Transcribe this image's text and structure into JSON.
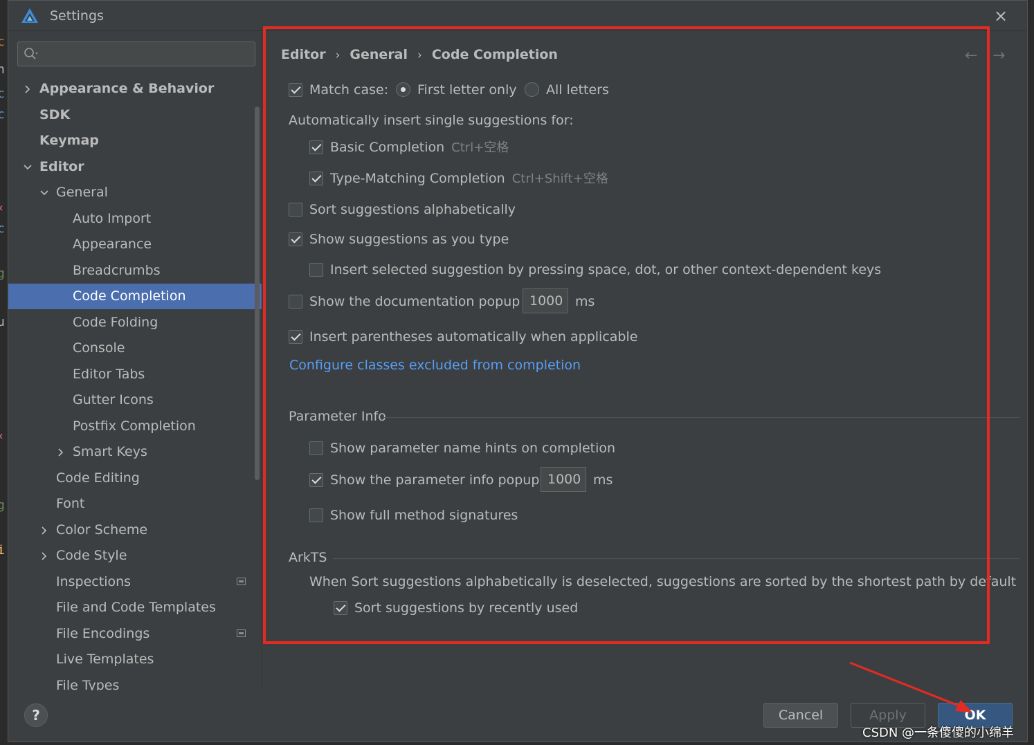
{
  "window": {
    "title": "Settings",
    "close_icon": "×"
  },
  "search": {
    "placeholder": ""
  },
  "sidebar": {
    "items": [
      {
        "label": "Appearance & Behavior",
        "bold": true,
        "arrow": "right"
      },
      {
        "label": "SDK",
        "bold": true
      },
      {
        "label": "Keymap",
        "bold": true
      },
      {
        "label": "Editor",
        "bold": true,
        "arrow": "down"
      },
      {
        "label": "General",
        "arrow": "down"
      },
      {
        "label": "Auto Import"
      },
      {
        "label": "Appearance"
      },
      {
        "label": "Breadcrumbs"
      },
      {
        "label": "Code Completion",
        "selected": true
      },
      {
        "label": "Code Folding"
      },
      {
        "label": "Console"
      },
      {
        "label": "Editor Tabs"
      },
      {
        "label": "Gutter Icons"
      },
      {
        "label": "Postfix Completion"
      },
      {
        "label": "Smart Keys",
        "arrow": "right"
      },
      {
        "label": "Code Editing"
      },
      {
        "label": "Font"
      },
      {
        "label": "Color Scheme",
        "arrow": "right"
      },
      {
        "label": "Code Style",
        "arrow": "right"
      },
      {
        "label": "Inspections",
        "badge": true
      },
      {
        "label": "File and Code Templates"
      },
      {
        "label": "File Encodings",
        "badge": true
      },
      {
        "label": "Live Templates"
      },
      {
        "label": "File Types"
      }
    ]
  },
  "breadcrumb": {
    "items": [
      "Editor",
      "General",
      "Code Completion"
    ],
    "separator": "›",
    "back_icon": "←",
    "forward_icon": "→"
  },
  "settings": {
    "match_case": {
      "label": "Match case:",
      "checked": true
    },
    "first_letter_only": {
      "label": "First letter only",
      "selected": true
    },
    "all_letters": {
      "label": "All letters",
      "selected": false
    },
    "auto_insert_header": "Automatically insert single suggestions for:",
    "basic_completion": {
      "label": "Basic Completion",
      "shortcut": "Ctrl+空格",
      "checked": true
    },
    "type_matching_completion": {
      "label": "Type-Matching Completion",
      "shortcut": "Ctrl+Shift+空格",
      "checked": true
    },
    "sort_alphabetically": {
      "label": "Sort suggestions alphabetically",
      "checked": false
    },
    "show_as_you_type": {
      "label": "Show suggestions as you type",
      "checked": true
    },
    "insert_selected_by_pressing": {
      "label": "Insert selected suggestion by pressing space, dot, or other context-dependent keys",
      "checked": false
    },
    "documentation_popup": {
      "label": "Show the documentation popup in",
      "value": "1000",
      "unit": "ms",
      "checked": false
    },
    "insert_parentheses": {
      "label": "Insert parentheses automatically when applicable",
      "checked": true
    },
    "configure_link": "Configure classes excluded from completion"
  },
  "parameter_info": {
    "title": "Parameter Info",
    "name_hints": {
      "label": "Show parameter name hints on completion",
      "checked": false
    },
    "info_popup": {
      "label": "Show the parameter info popup in",
      "value": "1000",
      "unit": "ms",
      "checked": true
    },
    "full_signatures": {
      "label": "Show full method signatures",
      "checked": false
    }
  },
  "arkts": {
    "title": "ArkTS",
    "note": "When Sort suggestions alphabetically is deselected, suggestions are sorted by the shortest path by default",
    "recently_used": {
      "label": "Sort suggestions by recently used",
      "checked": true
    }
  },
  "footer": {
    "help_label": "?",
    "cancel_label": "Cancel",
    "apply_label": "Apply",
    "ok_label": "OK"
  },
  "watermark": "CSDN @一条傻傻的小绵羊",
  "colors": {
    "background": "#3c3f41",
    "selection": "#4b6eaf",
    "link": "#589df6",
    "highlight_red": "#e52b21",
    "ok_button": "#365880"
  }
}
